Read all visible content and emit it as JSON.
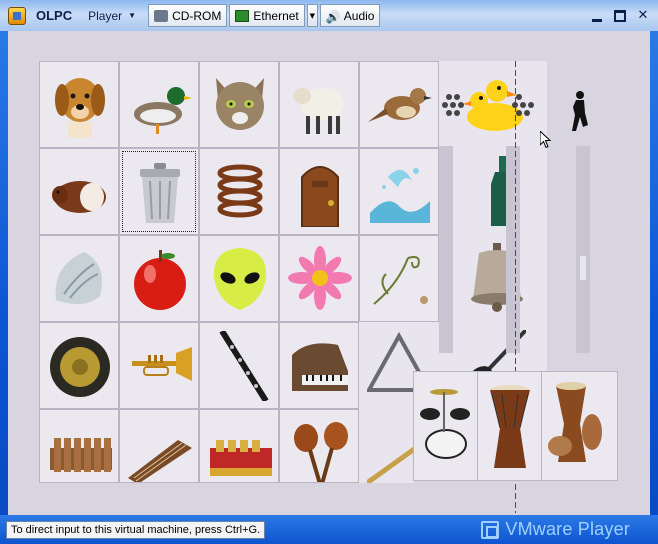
{
  "titlebar": {
    "app_title": "OLPC",
    "menu_label": "Player",
    "devices": [
      {
        "label": "CD-ROM",
        "icon": "cdrom-icon"
      },
      {
        "label": "Ethernet",
        "icon": "network-icon"
      },
      {
        "label": "Audio",
        "icon": "speaker-icon"
      }
    ]
  },
  "statusbar": {
    "hint": "To direct input to this virtual machine, press Ctrl+G.",
    "brand": "VMware Player"
  },
  "grid": {
    "rows": [
      [
        "dog",
        "duck",
        "cat",
        "sheep",
        "bird",
        "rubber-ducks"
      ],
      [
        "guinea-pig",
        "trash-can",
        "spring",
        "door",
        "water-splash",
        "bottle"
      ],
      [
        "seashell",
        "apple",
        "alien",
        "flower",
        "tendril",
        "bell"
      ],
      [
        "gong",
        "trumpet",
        "clarinet",
        "piano",
        "triangle",
        "guitar"
      ],
      [
        "xylophone",
        "guzheng",
        "gamelan",
        "maracas",
        "flute",
        ""
      ]
    ],
    "drum_panel": [
      "drum-kit",
      "djembe",
      "drums-group"
    ],
    "selected": "trash-can"
  },
  "colors": {
    "frame": "#0b55d4",
    "screen_bg": "#d8d4e0",
    "cell_bg": "#ebe8f0",
    "accent_red": "#c01818"
  }
}
